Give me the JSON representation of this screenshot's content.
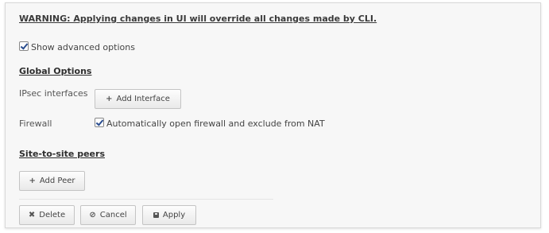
{
  "warning": "WARNING: Applying changes in UI will override all changes made by CLI.",
  "advanced": {
    "label": "Show advanced options",
    "checked": true
  },
  "global_options": {
    "title": "Global Options",
    "ipsec_label": "IPsec interfaces",
    "add_interface_label": "Add Interface",
    "firewall_label": "Firewall",
    "firewall_checkbox_label": "Automatically open firewall and exclude from NAT",
    "firewall_checked": true
  },
  "site_to_site": {
    "title": "Site-to-site peers",
    "add_peer_label": "Add Peer"
  },
  "actions": {
    "delete_label": "Delete",
    "cancel_label": "Cancel",
    "apply_label": "Apply"
  },
  "icons": {
    "add": "plus-icon",
    "delete": "x-icon",
    "cancel": "cancel-circle-icon",
    "apply": "save-icon",
    "check": "checkmark-icon"
  }
}
